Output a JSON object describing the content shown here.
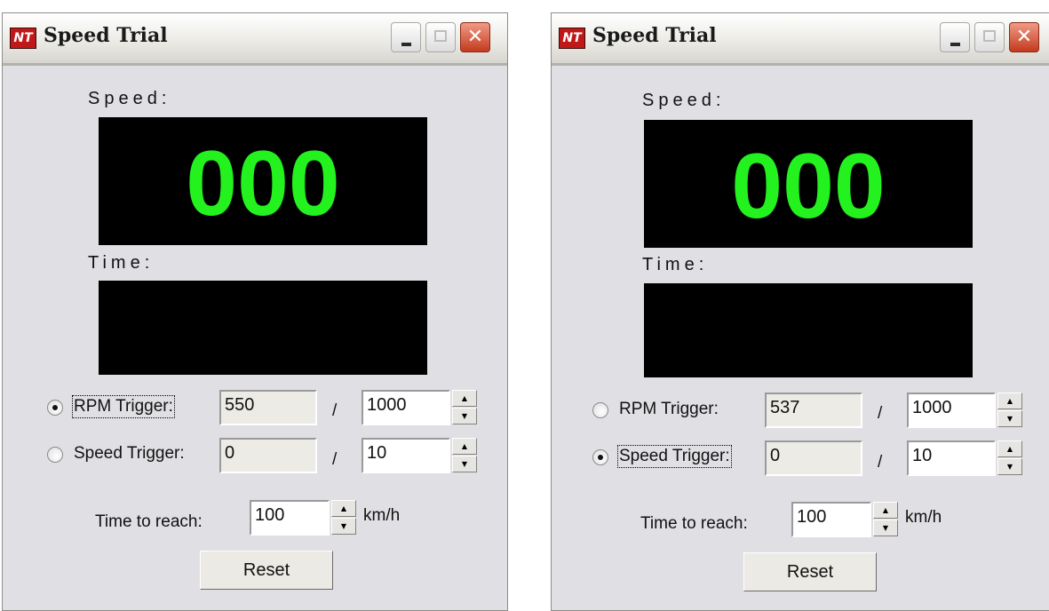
{
  "icons": {
    "logo": "app-logo-icon",
    "minimize": "minimize-icon",
    "maximize": "maximize-icon",
    "close": "close-icon"
  },
  "colors": {
    "display_bg": "#000000",
    "display_digits": "#23f21f",
    "window_bg": "#e0dfe3",
    "close_button": "#d14424"
  },
  "windows": [
    {
      "logo_text": "NT",
      "title": "Speed Trial",
      "speed_label": "Speed:",
      "speed_value": "000",
      "time_label": "Time:",
      "time_value": "",
      "rpm_trigger": {
        "label": "RPM Trigger:",
        "selected": true,
        "current": "550",
        "separator": "/",
        "target": "1000"
      },
      "speed_trigger": {
        "label": "Speed Trigger:",
        "selected": false,
        "current": "0",
        "separator": "/",
        "target": "10"
      },
      "time_to_reach": {
        "label": "Time to reach:",
        "value": "100",
        "unit": "km/h"
      },
      "reset_label": "Reset"
    },
    {
      "logo_text": "NT",
      "title": "Speed Trial",
      "speed_label": "Speed:",
      "speed_value": "000",
      "time_label": "Time:",
      "time_value": "",
      "rpm_trigger": {
        "label": "RPM Trigger:",
        "selected": false,
        "current": "537",
        "separator": "/",
        "target": "1000"
      },
      "speed_trigger": {
        "label": "Speed Trigger:",
        "selected": true,
        "current": "0",
        "separator": "/",
        "target": "10"
      },
      "time_to_reach": {
        "label": "Time to reach:",
        "value": "100",
        "unit": "km/h"
      },
      "reset_label": "Reset"
    }
  ]
}
